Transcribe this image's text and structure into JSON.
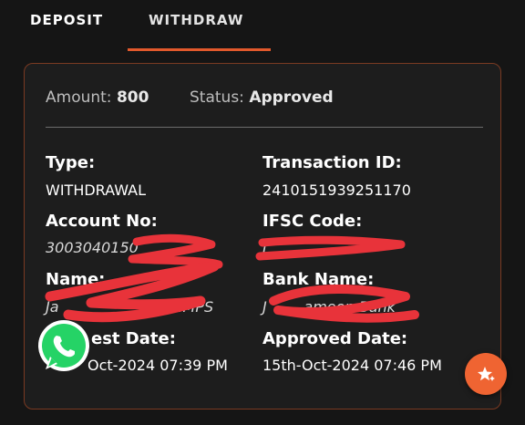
{
  "tabs": [
    {
      "label": "DEPOSIT"
    },
    {
      "label": "WITHDRAW",
      "active": true
    }
  ],
  "summary": {
    "amount_label": "Amount:",
    "amount_value": "800",
    "status_label": "Status:",
    "status_value": "Approved"
  },
  "details": {
    "type_label": "Type:",
    "type_value": "WITHDRAWAL",
    "txn_label": "Transaction ID:",
    "txn_value": "2410151939251170",
    "account_label": "Account No:",
    "account_value": "3003040150",
    "ifsc_label": "IFSC Code:",
    "ifsc_value": "I",
    "name_label": "Name:",
    "name_value": "Ja                     nk IMPS",
    "bank_label": "Bank Name:",
    "bank_value": "J        ameen Bank",
    "request_label": "est Date:",
    "request_value": "Oct-2024 07:39 PM",
    "approved_label": "Approved Date:",
    "approved_value": "15th-Oct-2024 07:46 PM"
  },
  "icons": {
    "whatsapp": "whatsapp-icon",
    "fab": "star-sparkle-icon"
  },
  "colors": {
    "accent": "#e2592c",
    "redaction": "#e8333a",
    "whatsapp": "#25d366"
  }
}
